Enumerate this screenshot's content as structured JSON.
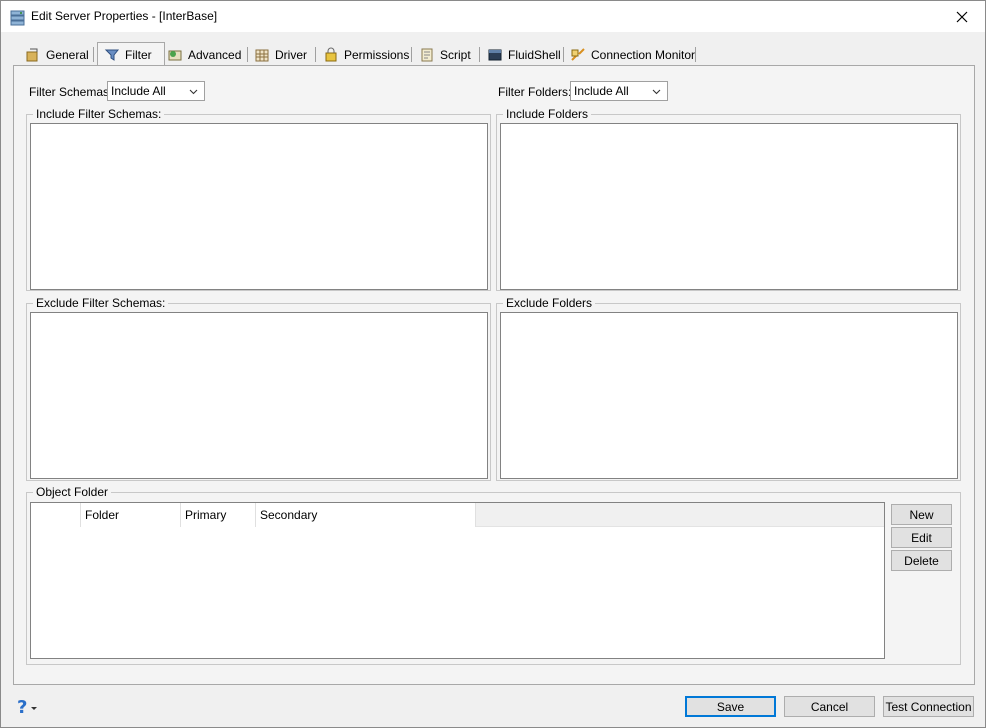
{
  "window": {
    "title": "Edit Server Properties - [InterBase]"
  },
  "tabs": [
    {
      "label": "General",
      "icon": "general-icon"
    },
    {
      "label": "Filter",
      "icon": "filter-icon",
      "active": true
    },
    {
      "label": "Advanced",
      "icon": "advanced-icon"
    },
    {
      "label": "Driver",
      "icon": "driver-icon"
    },
    {
      "label": "Permissions",
      "icon": "permissions-icon"
    },
    {
      "label": "Script",
      "icon": "script-icon"
    },
    {
      "label": "FluidShell",
      "icon": "fluidshell-icon"
    },
    {
      "label": "Connection Monitor",
      "icon": "connection-monitor-icon"
    }
  ],
  "filter": {
    "schemas_label": "Filter Schemas:",
    "schemas_value": "Include All",
    "folders_label": "Filter Folders:",
    "folders_value": "Include All"
  },
  "groups": {
    "include_schemas": "Include Filter Schemas:",
    "include_folders": "Include Folders",
    "exclude_schemas": "Exclude Filter Schemas:",
    "exclude_folders": "Exclude Folders",
    "object_folder": "Object Folder"
  },
  "table": {
    "columns": [
      "",
      "Folder",
      "Primary",
      "Secondary"
    ],
    "rows": []
  },
  "side_buttons": {
    "new": "New",
    "edit": "Edit",
    "delete": "Delete"
  },
  "footer": {
    "help": "?",
    "save": "Save",
    "cancel": "Cancel",
    "test": "Test Connection"
  },
  "colors": {
    "accent": "#0078d7",
    "background": "#f0f0f0"
  }
}
